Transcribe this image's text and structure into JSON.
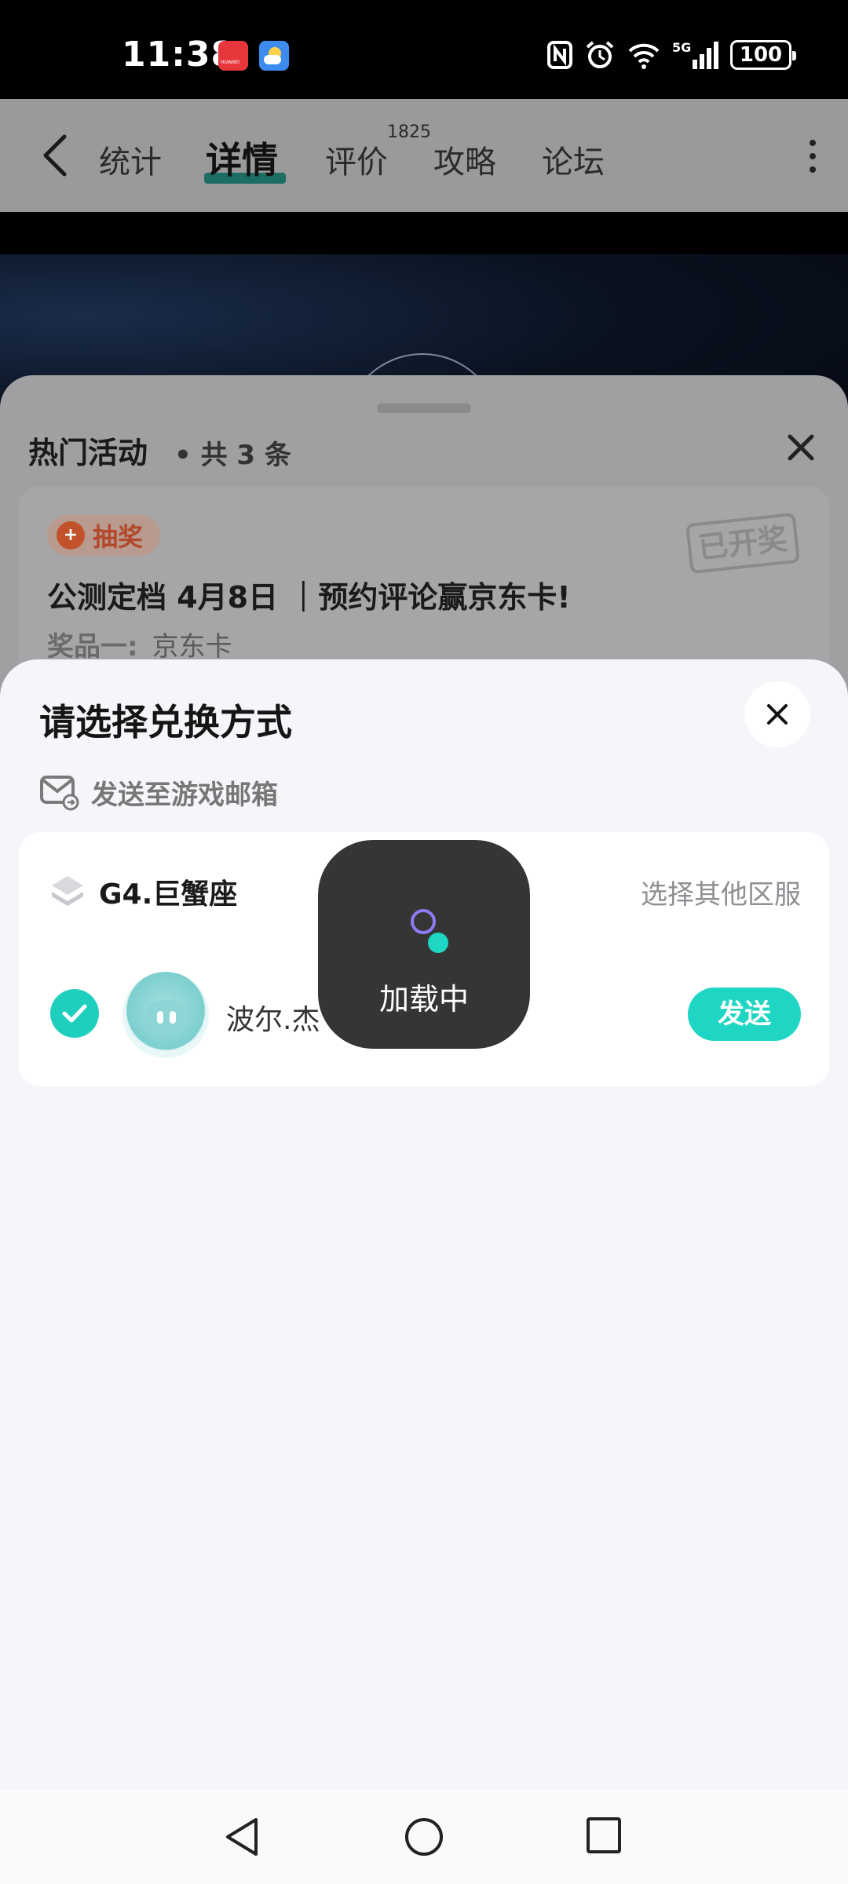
{
  "status_bar": {
    "time": "11:38",
    "battery": "100",
    "network": "5G"
  },
  "app_nav": {
    "tabs": [
      {
        "label": "统计"
      },
      {
        "label": "详情"
      },
      {
        "label": "评价"
      },
      {
        "label": "攻略"
      },
      {
        "label": "论坛"
      }
    ],
    "review_count": "1825",
    "active_tab": "详情"
  },
  "activity_sheet": {
    "title": "热门活动",
    "count": "• 共 3 条",
    "card": {
      "tag": "抽奖",
      "stamp": "已开奖",
      "headline": "公测定档 4月8日 ｜预约评论赢京东卡!",
      "prize_label": "奖品一:",
      "prize_value": "京东卡"
    }
  },
  "modal": {
    "title": "请选择兑换方式",
    "mail_option": "发送至游戏邮箱",
    "server": {
      "name": "G4.巨蟹座",
      "other_link": "选择其他区服"
    },
    "player": {
      "name": "波尔.杰",
      "selected": true
    },
    "send_button": "发送"
  },
  "loading_toast": {
    "label": "加载中"
  },
  "colors": {
    "accent": "#1fd6c4",
    "modal_bg": "#f4f6f9",
    "toast_bg": "#353535"
  }
}
